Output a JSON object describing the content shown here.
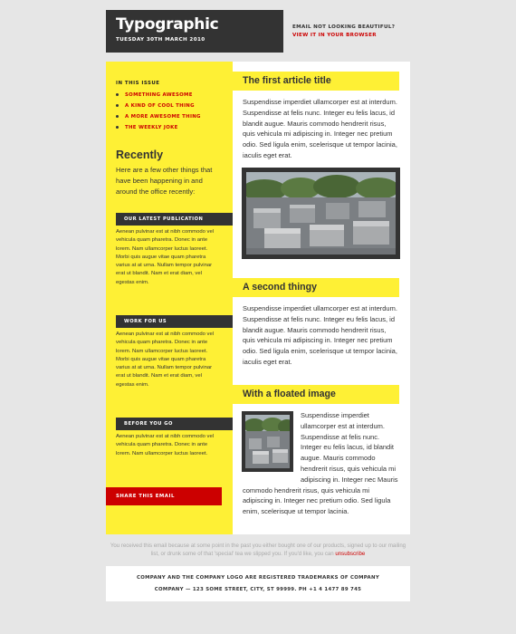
{
  "header": {
    "title": "Typographic",
    "date": "TUESDAY 30TH MARCH 2010",
    "notice_line1": "EMAIL NOT LOOKING BEAUTIFUL?",
    "notice_link": "VIEW IT IN YOUR BROWSER"
  },
  "sidebar": {
    "issue_heading": "IN THIS ISSUE",
    "issue_items": [
      "SOMETHING AWESOME",
      "A KIND OF COOL THING",
      "A MORE AWESOME THING",
      "THE WEEKLY JOKE"
    ],
    "recently_heading": "Recently",
    "recently_text": "Here are a few other things that have been happening in and around the office recently:",
    "sections": [
      {
        "heading": "OUR LATEST PUBLICATION",
        "text": "Aenean pulvinar est at nibh commodo vel vehicula quam pharetra. Donec in ante lorem. Nam ullamcorper luctus laoreet. Morbi quis augue vitae quam pharetra varius at at urna. Nullam tempor pulvinar erat ut blandit. Nam et erat diam, vel egestas enim."
      },
      {
        "heading": "WORK FOR US",
        "text": "Aenean pulvinar est at nibh commodo vel vehicula quam pharetra. Donec in ante lorem. Nam ullamcorper luctus laoreet. Morbi quis augue vitae quam pharetra varius at at urna. Nullam tempor pulvinar erat ut blandit. Nam et erat diam, vel egestas enim."
      },
      {
        "heading": "BEFORE YOU GO",
        "text": "Aenean pulvinar est at nibh commodo vel vehicula quam pharetra. Donec in ante lorem. Nam ullamcorper luctus laoreet."
      }
    ],
    "share_label": "SHARE THIS EMAIL"
  },
  "articles": [
    {
      "title": "The first article title",
      "text": "Suspendisse imperdiet ullamcorper est at interdum. Suspendisse at felis nunc. Integer eu felis lacus, id blandit augue. Mauris commodo hendrerit risus, quis vehicula mi adipiscing in. Integer nec pretium odio. Sed ligula enim, scelerisque ut tempor lacinia, iaculis eget erat."
    },
    {
      "title": "A second thingy",
      "text": "Suspendisse imperdiet ullamcorper est at interdum. Suspendisse at felis nunc. Integer eu felis lacus, id blandit augue. Mauris commodo hendrerit risus, quis vehicula mi adipiscing in. Integer nec pretium odio. Sed ligula enim, scelerisque ut tempor lacinia, iaculis eget erat."
    },
    {
      "title": "With a floated image",
      "text": "Suspendisse imperdiet ullamcorper est at interdum. Suspendisse at felis nunc. Integer eu felis lacus, id blandit augue. Mauris commodo hendrerit risus, quis vehicula mi adipiscing in. Integer nec Mauris commodo hendrerit risus, quis vehicula mi adipiscing in. Integer nec pretium odio. Sed ligula enim, scelerisque ut tempor lacinia."
    }
  ],
  "footer": {
    "disclaimer": "You received this email because at some point in the past you either bought one of our products, signed up to our mailing list, or drunk some of that 'special' tea we slipped you. If you'd like, you can",
    "unsubscribe": "unsubscribe",
    "line1": "COMPANY AND THE COMPANY LOGO ARE REGISTERED TRADEMARKS OF COMPANY",
    "line2": "COMPANY — 123 SOME STREET, CITY, ST 99999. PH +1 4 1477 89 745"
  },
  "colors": {
    "yellow": "#fef035",
    "red": "#cc0000",
    "dark": "#333333"
  },
  "icons": {
    "bullet": "bullet-dot-icon"
  }
}
